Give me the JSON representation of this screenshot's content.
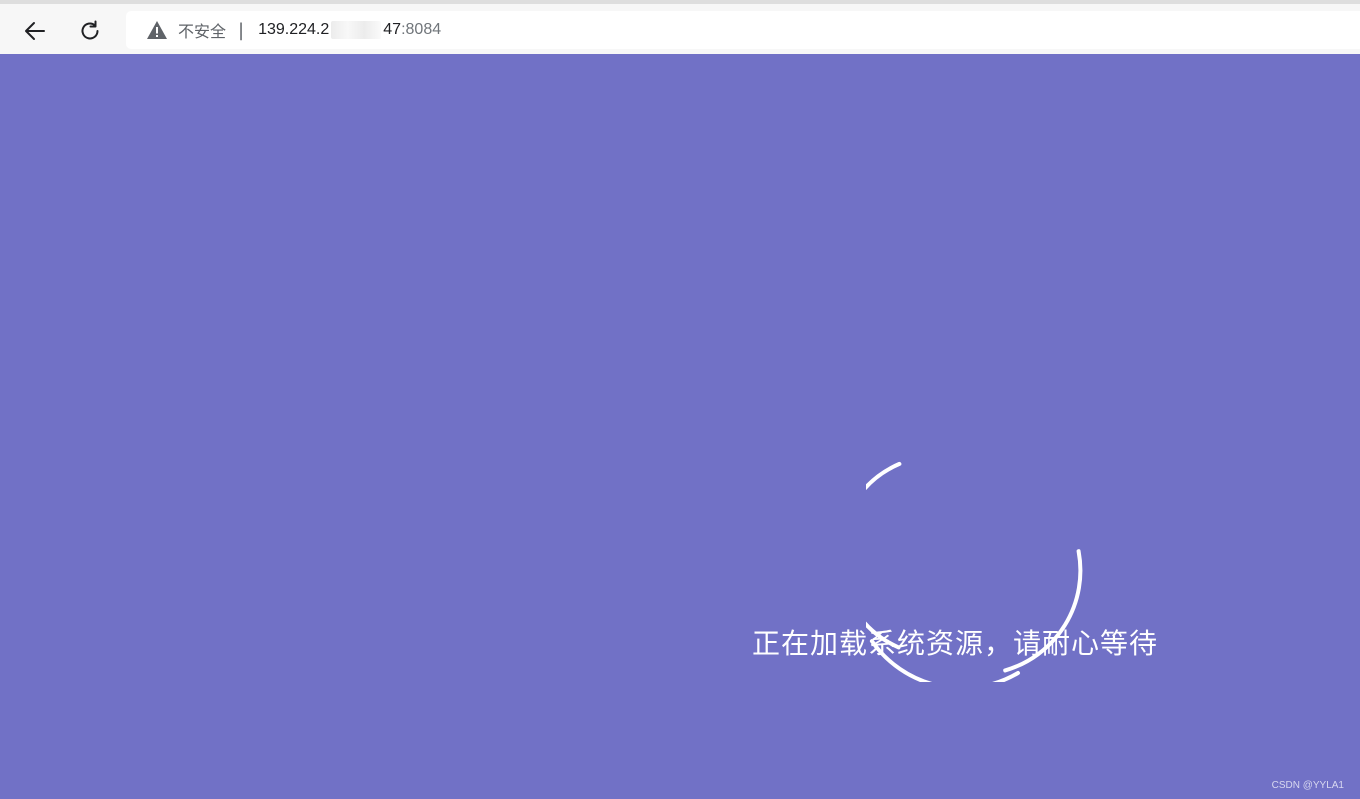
{
  "browser": {
    "security_label": "不安全",
    "separator": "|",
    "url_host": "139.224.2",
    "url_host_tail": "47",
    "url_port": ":8084",
    "icons": {
      "back": "arrow-left-icon",
      "reload": "reload-icon",
      "security": "warning-triangle-icon"
    }
  },
  "page": {
    "background_color": "#7171c6",
    "loading_message": "正在加载系统资源，请耐心等待",
    "spinner_color": "#ffffff"
  },
  "watermark": {
    "text": "CSDN @YYLA1"
  }
}
